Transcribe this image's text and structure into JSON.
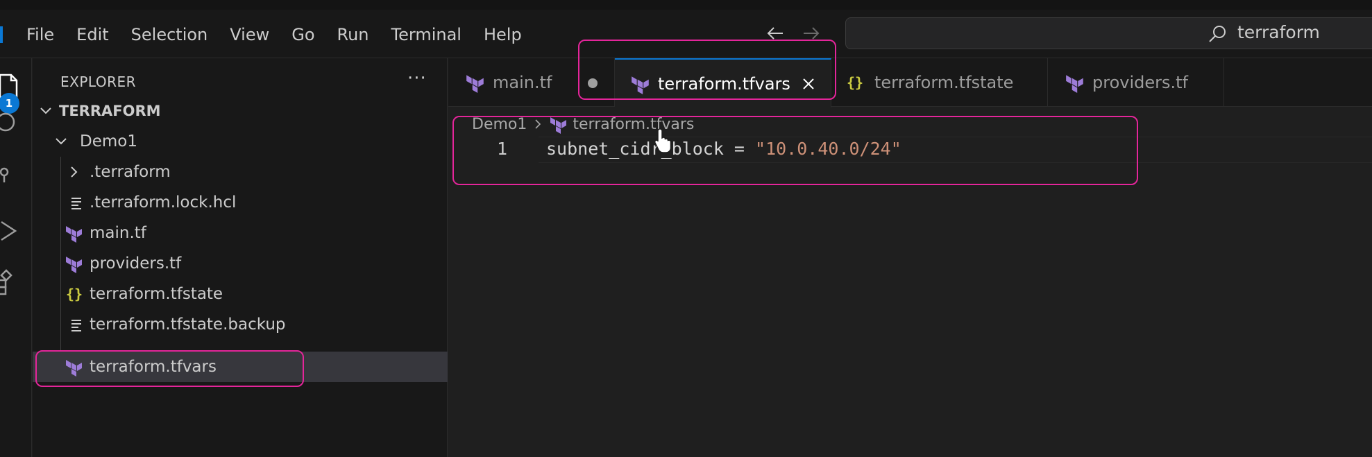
{
  "menu": [
    "File",
    "Edit",
    "Selection",
    "View",
    "Go",
    "Run",
    "Terminal",
    "Help"
  ],
  "search": {
    "text": "terraform"
  },
  "activity": {
    "badge": "1"
  },
  "sidebar": {
    "title": "EXPLORER",
    "more": "···",
    "root": "TERRAFORM",
    "folder": "Demo1",
    "items": [
      {
        "label": ".terraform",
        "type": "folder"
      },
      {
        "label": ".terraform.lock.hcl",
        "type": "text"
      },
      {
        "label": "main.tf",
        "type": "terraform"
      },
      {
        "label": "providers.tf",
        "type": "terraform"
      },
      {
        "label": "terraform.tfstate",
        "type": "json"
      },
      {
        "label": "terraform.tfstate.backup",
        "type": "text"
      },
      {
        "label": "terraform.tfvars",
        "type": "terraform"
      }
    ],
    "json_icon": "{}"
  },
  "tabs": [
    {
      "label": "main.tf"
    },
    {
      "label": "terraform.tfvars"
    },
    {
      "label": "terraform.tfstate"
    },
    {
      "label": "providers.tf"
    }
  ],
  "breadcrumb": {
    "folder": "Demo1",
    "file": "terraform.tfvars"
  },
  "editor": {
    "line_number": "1",
    "ident": "subnet_cidr_block",
    "op": " = ",
    "value": "\"10.0.40.0/24\""
  },
  "colors": {
    "accent": "#0a78d4",
    "terraform_purple": "#9d7cd8",
    "annotation": "#e4259a",
    "string": "#ce9178"
  }
}
